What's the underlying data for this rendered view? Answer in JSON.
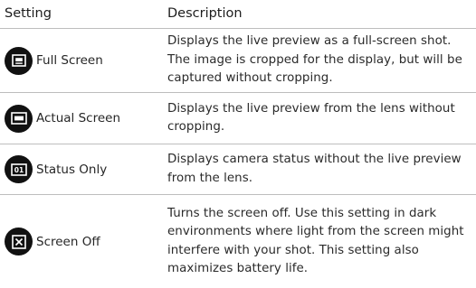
{
  "header": {
    "setting": "Setting",
    "description": "Description"
  },
  "rows": [
    {
      "icon": "full-screen-icon",
      "setting": "Full Screen",
      "description": "Displays the live preview as a full-screen shot. The image is cropped for the display, but will be captured without cropping."
    },
    {
      "icon": "actual-screen-icon",
      "setting": "Actual Screen",
      "description": "Displays the live preview from the lens without cropping."
    },
    {
      "icon": "status-only-icon",
      "icon_text": "01",
      "setting": "Status Only",
      "description": "Displays camera status without the live preview from the lens."
    },
    {
      "icon": "screen-off-icon",
      "setting": "Screen Off",
      "description": "Turns the screen off. Use this setting in dark environments where light from the screen might interfere with your shot. This setting also maximizes battery life."
    }
  ],
  "colors": {
    "icon_background": "#111111",
    "icon_foreground": "#ffffff",
    "divider": "#bdbdbd",
    "text": "#222222"
  }
}
